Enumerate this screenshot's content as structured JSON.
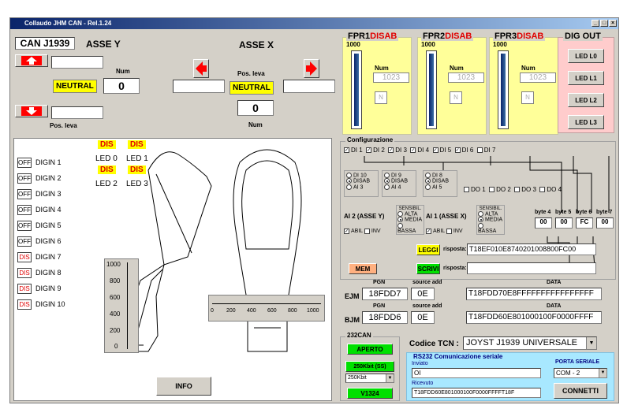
{
  "window": {
    "title": "Collaudo JHM CAN - Rel.1.24",
    "min": "_",
    "max": "□",
    "close": "×"
  },
  "header": {
    "can_label": "CAN J1939",
    "asse_y": "ASSE Y",
    "asse_x": "ASSE X"
  },
  "axis_y": {
    "num_label": "Num",
    "neutral": "NEUTRAL",
    "num_value": "0",
    "pos_label": "Pos. leva"
  },
  "axis_x": {
    "pos_label": "Pos. leva",
    "neutral": "NEUTRAL",
    "num_value": "0",
    "num_label": "Num"
  },
  "fpr": [
    {
      "name": "FPR1",
      "state": "DISAB",
      "max": "1000",
      "num_label": "Num",
      "num_value": "1023",
      "n": "N"
    },
    {
      "name": "FPR2",
      "state": "DISAB",
      "max": "1000",
      "num_label": "Num",
      "num_value": "1023",
      "n": "N"
    },
    {
      "name": "FPR3",
      "state": "DISAB",
      "max": "1000",
      "num_label": "Num",
      "num_value": "1023",
      "n": "N"
    }
  ],
  "dig_out": {
    "title": "DIG OUT",
    "buttons": [
      "LED L0",
      "LED L1",
      "LED L2",
      "LED L3"
    ]
  },
  "leds": [
    {
      "state": "DIS",
      "label": "LED 0"
    },
    {
      "state": "DIS",
      "label": "LED 1"
    },
    {
      "state": "DIS",
      "label": "LED 2"
    },
    {
      "state": "DIS",
      "label": "LED 3"
    }
  ],
  "digin": [
    {
      "state": "OFF",
      "label": "DIGIN 1"
    },
    {
      "state": "OFF",
      "label": "DIGIN 2"
    },
    {
      "state": "OFF",
      "label": "DIGIN 3"
    },
    {
      "state": "OFF",
      "label": "DIGIN 4"
    },
    {
      "state": "OFF",
      "label": "DIGIN 5"
    },
    {
      "state": "OFF",
      "label": "DIGIN 6"
    },
    {
      "state": "DIS",
      "label": "DIGIN 7"
    },
    {
      "state": "DIS",
      "label": "DIGIN 8"
    },
    {
      "state": "DIS",
      "label": "DIGIN 9"
    },
    {
      "state": "DIS",
      "label": "DIGIN 10"
    }
  ],
  "v_scale": [
    "1000",
    "800",
    "600",
    "400",
    "200",
    "0"
  ],
  "h_scale": [
    "0",
    "200",
    "400",
    "600",
    "800",
    "1000"
  ],
  "info_button": "INFO",
  "config": {
    "title": "Configurazione",
    "di_checks": [
      "DI 1",
      "DI 2",
      "DI 3",
      "DI 4",
      "DI 5",
      "DI 6",
      "DI 7"
    ],
    "group1": [
      "DI 10",
      "DISAB",
      "AI 3"
    ],
    "group2": [
      "DI 9",
      "DISAB",
      "AI 4"
    ],
    "group3": [
      "DI 8",
      "DISAB",
      "AI 5"
    ],
    "do_checks": [
      "DO 1",
      "DO 2",
      "DO 3",
      "DO 4"
    ],
    "ai2_label": "AI 2 (ASSE Y)",
    "ai1_label": "AI 1 (ASSE X)",
    "sensibil_title": "SENSIBIL.",
    "sensibil": [
      "ALTA",
      "MEDIA",
      "BASSA"
    ],
    "abil": "ABIL",
    "inv": "INV",
    "bytes_headers": [
      "byte 4",
      "byte 5",
      "byte 6",
      "byte 7"
    ],
    "bytes_values": [
      "00",
      "00",
      "FC",
      "00"
    ],
    "leggi": "LEGGI",
    "scrivi": "SCRIVI",
    "mem": "MEM",
    "risposta_label": "risposta:",
    "risposta_value": "T18EF010E8740201008800FC00",
    "risposta2_label": "risposta:"
  },
  "ejm": {
    "row_label": "EJM",
    "pgn_header": "PGN",
    "src_header": "source add",
    "data_header": "DATA",
    "pgn": "18FDD7",
    "src": "0E",
    "data": "T18FDD70E8FFFFFFFFFFFFFFFF"
  },
  "bjm": {
    "row_label": "BJM",
    "pgn_header": "PGN",
    "src_header": "source add",
    "data_header": "DATA",
    "pgn": "18FDD6",
    "src": "0E",
    "data": "T18FDD60E801000100F0000FFFF"
  },
  "can232": {
    "title": "232CAN",
    "aperto": "APERTO",
    "speed_btn": "250Kbit (SS)",
    "speed_sel": "250Kbit",
    "version": "V1324"
  },
  "codice": {
    "label": "Codice TCN :",
    "value": "JOYST J1939  UNIVERSALE"
  },
  "rs232": {
    "title": "RS232  Comunicazione seriale",
    "inviato_label": "Inviato",
    "inviato_value": "OI",
    "porta_label": "PORTA SERIALE",
    "porta_value": "COM - 2",
    "ricevuto_label": "Ricevuto",
    "ricevuto_value": "T18FDD60E801000100F0000FFFFT18F",
    "connetti": "CONNETTI"
  }
}
